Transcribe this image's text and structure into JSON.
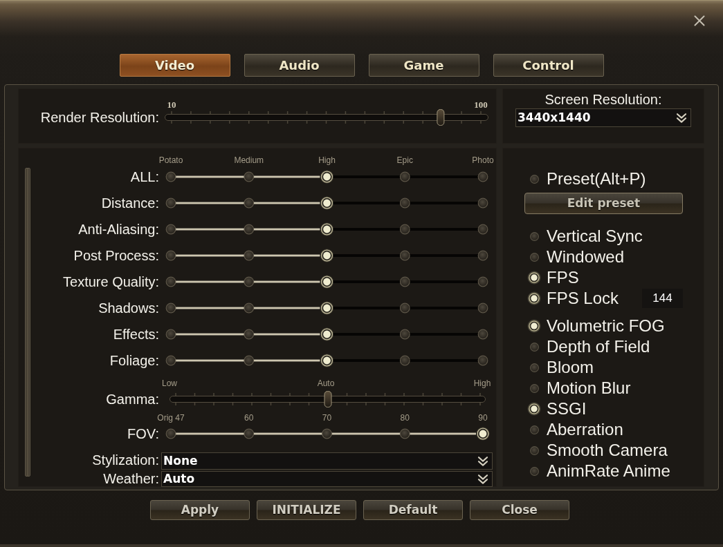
{
  "tabs": [
    {
      "label": "Video",
      "selected": true
    },
    {
      "label": "Audio",
      "selected": false
    },
    {
      "label": "Game",
      "selected": false
    },
    {
      "label": "Control",
      "selected": false
    }
  ],
  "render_resolution": {
    "label": "Render Resolution:",
    "scale": [
      "10",
      "100"
    ],
    "level": 0.87
  },
  "screen_resolution": {
    "label": "Screen Resolution:",
    "value": "3440x1440"
  },
  "quality": {
    "scale": [
      "Potato",
      "Medium",
      "High",
      "Epic",
      "Photo"
    ],
    "sliders": [
      {
        "label": "ALL:",
        "level": 0.5
      },
      {
        "label": "Distance:",
        "level": 0.5
      },
      {
        "label": "Anti-Aliasing:",
        "level": 0.5
      },
      {
        "label": "Post Process:",
        "level": 0.5
      },
      {
        "label": "Texture Quality:",
        "level": 0.5
      },
      {
        "label": "Shadows:",
        "level": 0.5
      },
      {
        "label": "Effects:",
        "level": 0.5
      },
      {
        "label": "Foliage:",
        "level": 0.5
      }
    ]
  },
  "gamma": {
    "label": "Gamma:",
    "scale": [
      "Low",
      "Auto",
      "High"
    ],
    "level": 0.5
  },
  "fov": {
    "label": "FOV:",
    "scale": [
      "Orig 47",
      "60",
      "70",
      "80",
      "90"
    ],
    "level": 1
  },
  "dropdowns": [
    {
      "label": "Stylization:",
      "value": "None"
    },
    {
      "label": "Weather:",
      "value": "Auto"
    }
  ],
  "preset": {
    "label": "Preset(Alt+P)",
    "on": false,
    "button": "Edit preset"
  },
  "toggle_groups": [
    {
      "toggles": [
        {
          "label": "Vertical Sync",
          "on": false
        },
        {
          "label": "Windowed",
          "on": false
        },
        {
          "label": "FPS",
          "on": true
        },
        {
          "label": "FPS Lock",
          "on": true,
          "value": "144"
        }
      ]
    },
    {
      "toggles": [
        {
          "label": "Volumetric FOG",
          "on": true
        },
        {
          "label": "Depth of Field",
          "on": false
        },
        {
          "label": "Bloom",
          "on": false
        },
        {
          "label": "Motion Blur",
          "on": false
        },
        {
          "label": "SSGI",
          "on": true
        },
        {
          "label": "Aberration",
          "on": false
        },
        {
          "label": "Smooth Camera",
          "on": false
        },
        {
          "label": "AnimRate Anime",
          "on": false
        }
      ]
    }
  ],
  "buttons": [
    "Apply",
    "INITIALIZE",
    "Default",
    "Close"
  ]
}
